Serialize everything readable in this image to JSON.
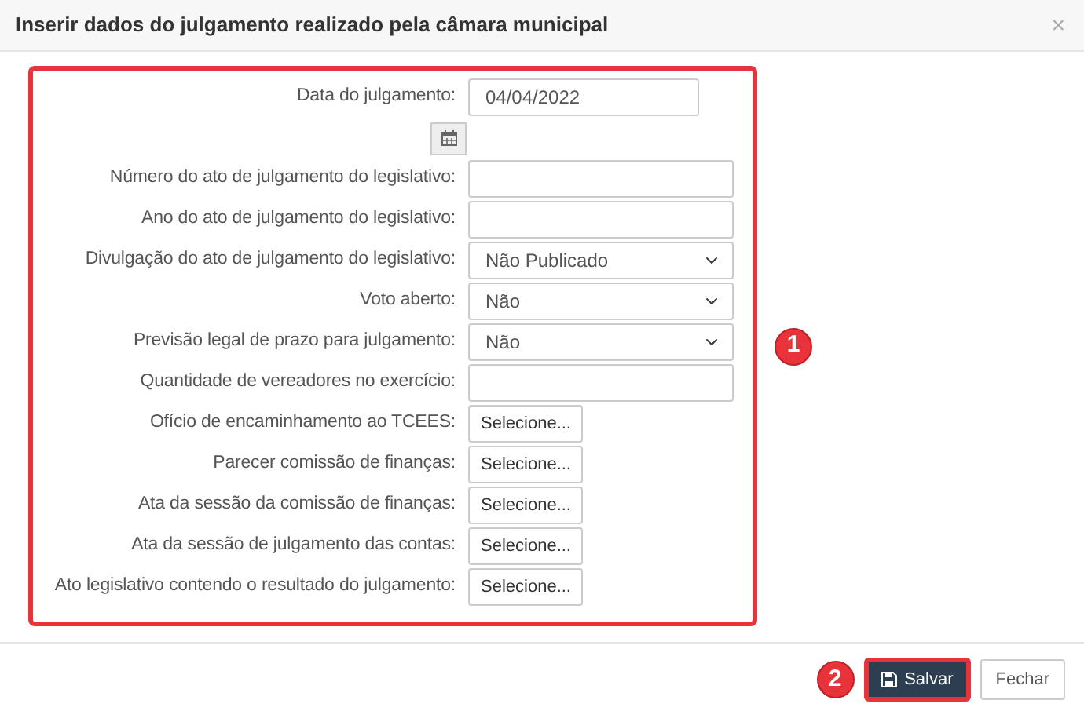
{
  "dialog": {
    "title": "Inserir dados do julgamento realizado pela câmara municipal",
    "close": "×"
  },
  "fields": [
    {
      "label": "Data do julgamento:",
      "kind": "date",
      "value": "04/04/2022"
    },
    {
      "label": "Número do ato de julgamento do legislativo:",
      "kind": "text"
    },
    {
      "label": "Ano do ato de julgamento do legislativo:",
      "kind": "text"
    },
    {
      "label": "Divulgação do ato de julgamento do legislativo:",
      "kind": "select",
      "value": "Não Publicado"
    },
    {
      "label": "Voto aberto:",
      "kind": "select",
      "value": "Não"
    },
    {
      "label": "Previsão legal de prazo para julgamento:",
      "kind": "select",
      "value": "Não"
    },
    {
      "label": "Quantidade de vereadores no exercício:",
      "kind": "text"
    },
    {
      "label": "Ofício de encaminhamento ao TCEES:",
      "kind": "file",
      "value": "Selecione..."
    },
    {
      "label": "Parecer comissão de finanças:",
      "kind": "file",
      "value": "Selecione..."
    },
    {
      "label": "Ata da sessão da comissão de finanças:",
      "kind": "file",
      "value": "Selecione..."
    },
    {
      "label": "Ata da sessão de julgamento das contas:",
      "kind": "file",
      "value": "Selecione..."
    },
    {
      "label": "Ato legislativo contendo o resultado do julgamento:",
      "kind": "file",
      "value": "Selecione..."
    }
  ],
  "buttons": [
    {
      "label": "Salvar",
      "kind": "primary",
      "callout": "2"
    },
    {
      "label": "Fechar",
      "kind": "secondary"
    }
  ],
  "form_callout": "1"
}
